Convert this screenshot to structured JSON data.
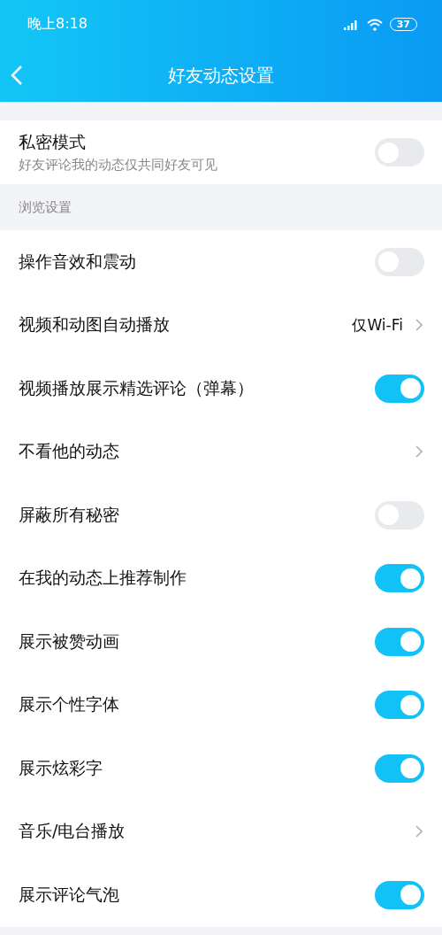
{
  "status_bar": {
    "time": "晚上8:18",
    "battery": "37"
  },
  "header": {
    "title": "好友动态设置"
  },
  "private_mode": {
    "label": "私密模式",
    "description": "好友评论我的动态仅共同好友可见",
    "on": false
  },
  "section": {
    "title": "浏览设置"
  },
  "items": [
    {
      "kind": "toggle",
      "label": "操作音效和震动",
      "on": false
    },
    {
      "kind": "link",
      "label": "视频和动图自动播放",
      "value": "仅Wi-Fi"
    },
    {
      "kind": "toggle",
      "label": "视频播放展示精选评论（弹幕）",
      "on": true
    },
    {
      "kind": "link",
      "label": "不看他的动态"
    },
    {
      "kind": "toggle",
      "label": "屏蔽所有秘密",
      "on": false
    },
    {
      "kind": "toggle",
      "label": "在我的动态上推荐制作",
      "on": true
    },
    {
      "kind": "toggle",
      "label": "展示被赞动画",
      "on": true
    },
    {
      "kind": "toggle",
      "label": "展示个性字体",
      "on": true
    },
    {
      "kind": "toggle",
      "label": "展示炫彩字",
      "on": true
    },
    {
      "kind": "link",
      "label": "音乐/电台播放"
    },
    {
      "kind": "toggle",
      "label": "展示评论气泡",
      "on": true
    }
  ]
}
